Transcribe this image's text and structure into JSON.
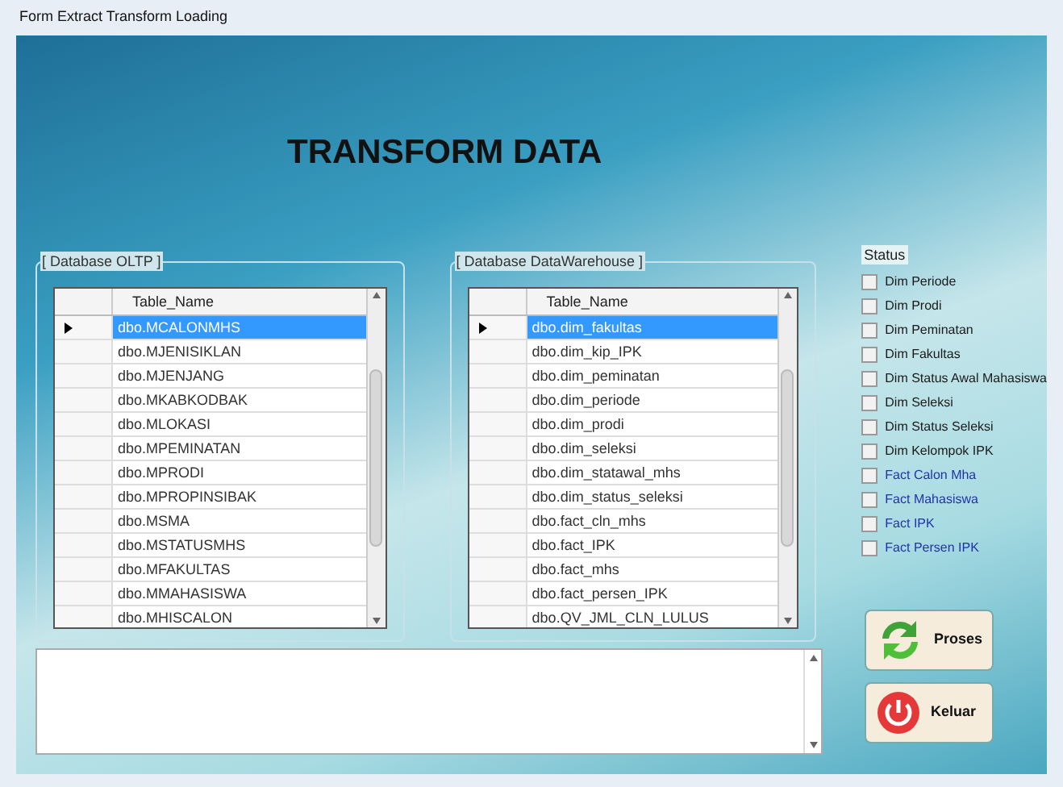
{
  "window": {
    "title": "Form Extract Transform Loading"
  },
  "heading": "TRANSFORM DATA",
  "oltp": {
    "title": "[ Database OLTP ]",
    "column": "Table_Name",
    "rows": [
      {
        "name": "dbo.MCALONMHS",
        "selected": true
      },
      {
        "name": "dbo.MJENISIKLAN",
        "selected": false
      },
      {
        "name": "dbo.MJENJANG",
        "selected": false
      },
      {
        "name": "dbo.MKABKODBAK",
        "selected": false
      },
      {
        "name": "dbo.MLOKASI",
        "selected": false
      },
      {
        "name": "dbo.MPEMINATAN",
        "selected": false
      },
      {
        "name": "dbo.MPRODI",
        "selected": false
      },
      {
        "name": "dbo.MPROPINSIBAK",
        "selected": false
      },
      {
        "name": "dbo.MSMA",
        "selected": false
      },
      {
        "name": "dbo.MSTATUSMHS",
        "selected": false
      },
      {
        "name": "dbo.MFAKULTAS",
        "selected": false
      },
      {
        "name": "dbo.MMAHASISWA",
        "selected": false
      },
      {
        "name": "dbo.MHISCALON",
        "selected": false
      }
    ]
  },
  "warehouse": {
    "title": "[ Database DataWarehouse ]",
    "column": "Table_Name",
    "rows": [
      {
        "name": "dbo.dim_fakultas",
        "selected": true
      },
      {
        "name": "dbo.dim_kip_IPK",
        "selected": false
      },
      {
        "name": "dbo.dim_peminatan",
        "selected": false
      },
      {
        "name": "dbo.dim_periode",
        "selected": false
      },
      {
        "name": "dbo.dim_prodi",
        "selected": false
      },
      {
        "name": "dbo.dim_seleksi",
        "selected": false
      },
      {
        "name": "dbo.dim_statawal_mhs",
        "selected": false
      },
      {
        "name": "dbo.dim_status_seleksi",
        "selected": false
      },
      {
        "name": "dbo.fact_cln_mhs",
        "selected": false
      },
      {
        "name": "dbo.fact_IPK",
        "selected": false
      },
      {
        "name": "dbo.fact_mhs",
        "selected": false
      },
      {
        "name": "dbo.fact_persen_IPK",
        "selected": false
      },
      {
        "name": "dbo.QV_JML_CLN_LULUS",
        "selected": false
      }
    ]
  },
  "status": {
    "title": "Status",
    "items": [
      {
        "label": "Dim Periode",
        "checked": false,
        "color": "#1a1a1a"
      },
      {
        "label": "Dim Prodi",
        "checked": false,
        "color": "#1a1a1a"
      },
      {
        "label": "Dim Peminatan",
        "checked": false,
        "color": "#1a1a1a"
      },
      {
        "label": "Dim Fakultas",
        "checked": false,
        "color": "#1a1a1a"
      },
      {
        "label": "Dim Status Awal Mahasiswa",
        "checked": false,
        "color": "#1a1a1a"
      },
      {
        "label": "Dim Seleksi",
        "checked": false,
        "color": "#1a1a1a"
      },
      {
        "label": "Dim Status Seleksi",
        "checked": false,
        "color": "#1a1a1a"
      },
      {
        "label": "Dim Kelompok IPK",
        "checked": false,
        "color": "#1a1a1a"
      },
      {
        "label": "Fact Calon Mha",
        "checked": false,
        "color": "#2233aa"
      },
      {
        "label": "Fact Mahasiswa",
        "checked": false,
        "color": "#2233aa"
      },
      {
        "label": "Fact IPK",
        "checked": false,
        "color": "#2233aa"
      },
      {
        "label": "Fact Persen IPK",
        "checked": false,
        "color": "#2233aa"
      }
    ]
  },
  "buttons": [
    {
      "label": "Proses",
      "kind": "process"
    },
    {
      "label": "Keluar",
      "kind": "exit"
    }
  ]
}
